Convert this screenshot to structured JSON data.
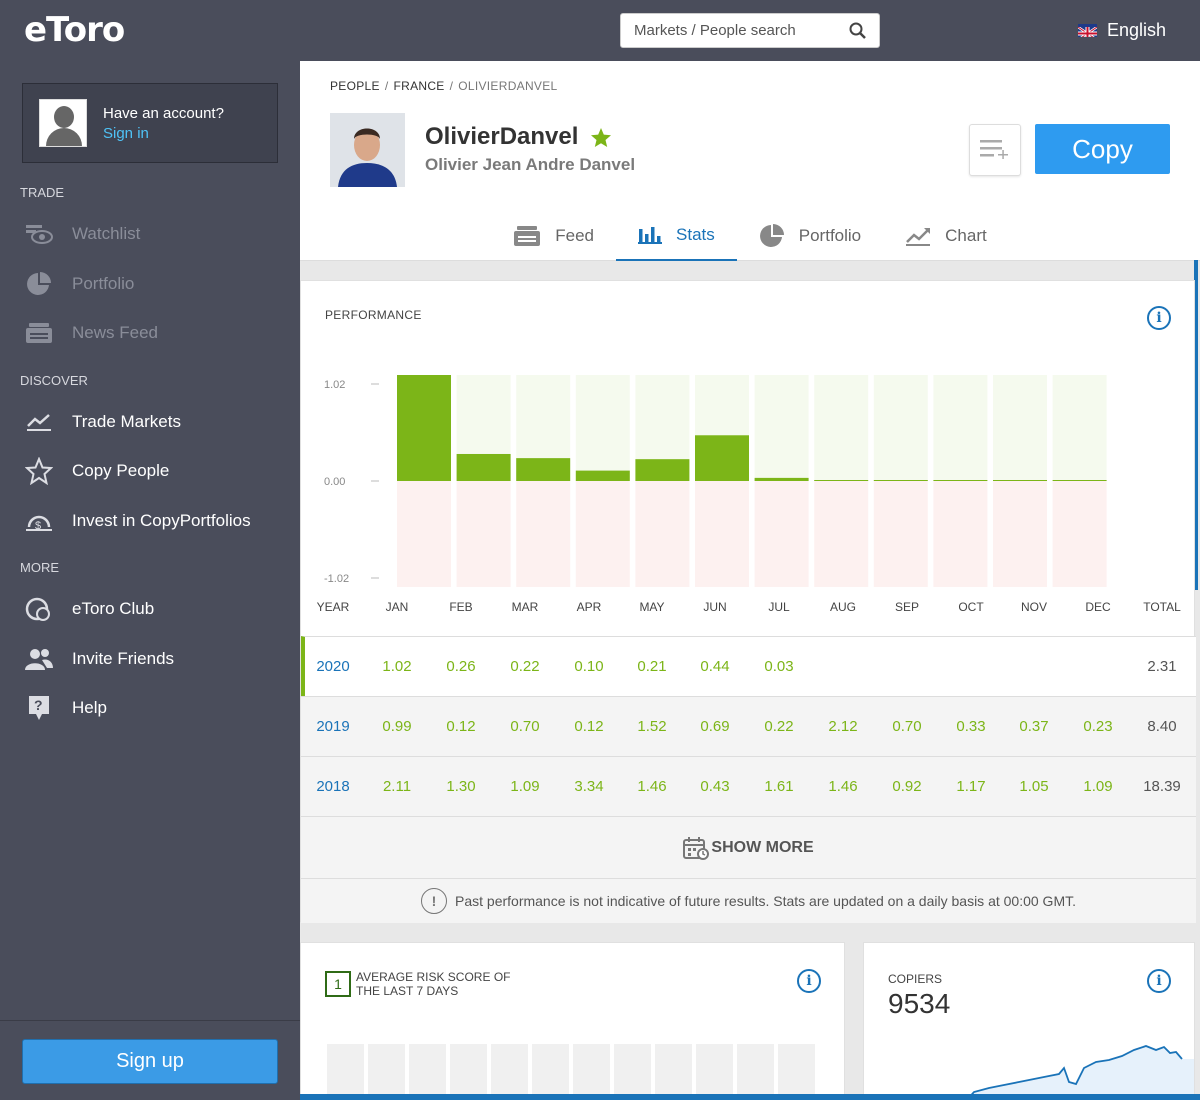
{
  "app": {
    "logo": "eToro"
  },
  "sidebar": {
    "account": {
      "title": "Have an account?",
      "sign_in": "Sign in"
    },
    "sections": {
      "trade": "TRADE",
      "discover": "DISCOVER",
      "more": "MORE"
    },
    "items": [
      {
        "label": "Watchlist",
        "icon": "eye-icon",
        "disabled": true
      },
      {
        "label": "Portfolio",
        "icon": "pie-chart-icon",
        "disabled": true
      },
      {
        "label": "News Feed",
        "icon": "news-feed-icon",
        "disabled": true
      },
      {
        "label": "Trade Markets",
        "icon": "trend-chart-icon"
      },
      {
        "label": "Copy People",
        "icon": "star-icon"
      },
      {
        "label": "Invest in CopyPortfolios",
        "icon": "dollar-cycle-icon"
      },
      {
        "label": "eToro Club",
        "icon": "club-icon"
      },
      {
        "label": "Invite Friends",
        "icon": "people-icon"
      },
      {
        "label": "Help",
        "icon": "help-icon"
      }
    ],
    "signup": "Sign up"
  },
  "topbar": {
    "search_placeholder": "Markets / People search",
    "language": "English"
  },
  "profile": {
    "breadcrumb": [
      "PEOPLE",
      "FRANCE",
      "OLIVIERDANVEL"
    ],
    "username": "OlivierDanvel",
    "full_name": "Olivier Jean Andre Danvel",
    "copy_label": "Copy"
  },
  "tabs": [
    {
      "label": "Feed",
      "icon": "feed-icon"
    },
    {
      "label": "Stats",
      "icon": "bar-chart-icon",
      "active": true
    },
    {
      "label": "Portfolio",
      "icon": "pie-chart-icon"
    },
    {
      "label": "Chart",
      "icon": "line-chart-icon"
    }
  ],
  "performance": {
    "title": "PERFORMANCE",
    "columns": [
      "YEAR",
      "JAN",
      "FEB",
      "MAR",
      "APR",
      "MAY",
      "JUN",
      "JUL",
      "AUG",
      "SEP",
      "OCT",
      "NOV",
      "DEC",
      "TOTAL"
    ],
    "rows": [
      {
        "year": "2020",
        "values": [
          "1.02",
          "0.26",
          "0.22",
          "0.10",
          "0.21",
          "0.44",
          "0.03",
          "",
          "",
          "",
          "",
          ""
        ],
        "total": "2.31"
      },
      {
        "year": "2019",
        "values": [
          "0.99",
          "0.12",
          "0.70",
          "0.12",
          "1.52",
          "0.69",
          "0.22",
          "2.12",
          "0.70",
          "0.33",
          "0.37",
          "0.23"
        ],
        "total": "8.40"
      },
      {
        "year": "2018",
        "values": [
          "2.11",
          "1.30",
          "1.09",
          "3.34",
          "1.46",
          "0.43",
          "1.61",
          "1.46",
          "0.92",
          "1.17",
          "1.05",
          "1.09"
        ],
        "total": "18.39"
      }
    ],
    "show_more": "SHOW MORE",
    "disclaimer": "Past performance is not indicative of future results. Stats are updated on a daily basis at 00:00 GMT."
  },
  "chart_data": {
    "type": "bar",
    "categories": [
      "JAN",
      "FEB",
      "MAR",
      "APR",
      "MAY",
      "JUN",
      "JUL",
      "AUG",
      "SEP",
      "OCT",
      "NOV",
      "DEC"
    ],
    "values": [
      1.02,
      0.26,
      0.22,
      0.1,
      0.21,
      0.44,
      0.03,
      0,
      0,
      0,
      0,
      0
    ],
    "yticks": [
      "1.02",
      "0.00",
      "-1.02"
    ],
    "ylim": [
      -1.02,
      1.02
    ],
    "colors": {
      "positive": "#7cb518",
      "positive_bg": "#f5faee",
      "negative_bg": "#fdf1f0"
    }
  },
  "risk": {
    "score": "1",
    "label": "AVERAGE RISK SCORE OF THE LAST 7 DAYS"
  },
  "copiers": {
    "label": "COPIERS",
    "value": "9534"
  }
}
